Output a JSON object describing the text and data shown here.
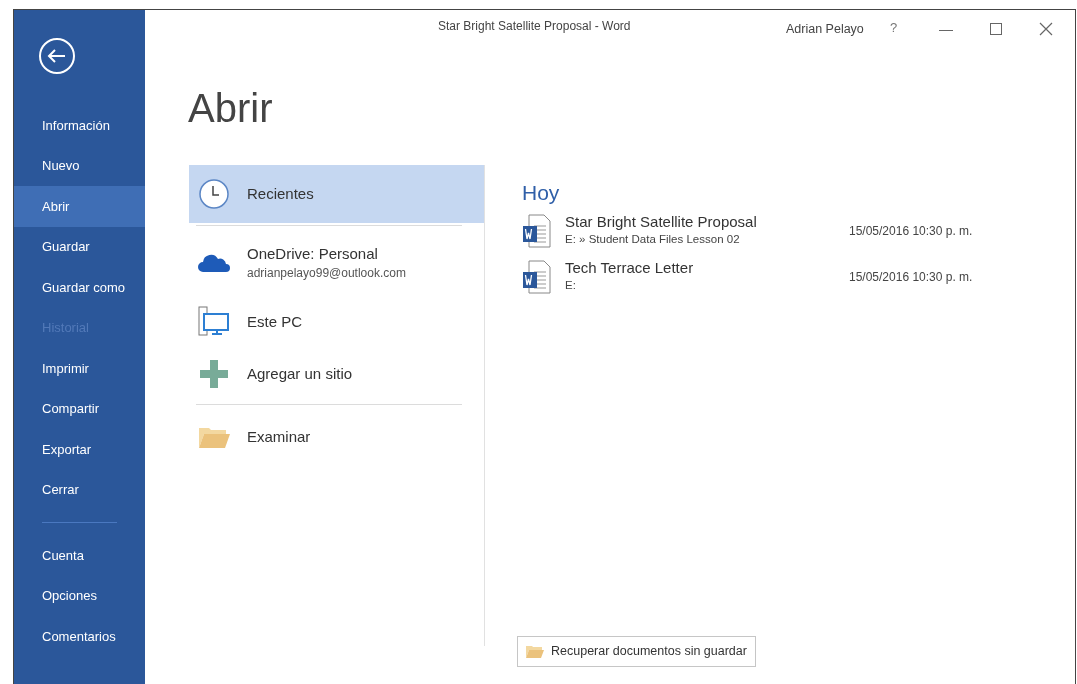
{
  "window": {
    "title": "Star Bright Satellite Proposal - Word",
    "user": "Adrian Pelayo",
    "help": "?"
  },
  "sidebar": {
    "items": [
      {
        "label": "Información",
        "selected": false,
        "disabled": false
      },
      {
        "label": "Nuevo",
        "selected": false,
        "disabled": false
      },
      {
        "label": "Abrir",
        "selected": true,
        "disabled": false
      },
      {
        "label": "Guardar",
        "selected": false,
        "disabled": false
      },
      {
        "label": "Guardar como",
        "selected": false,
        "disabled": false
      },
      {
        "label": "Historial",
        "selected": false,
        "disabled": true
      },
      {
        "label": "Imprimir",
        "selected": false,
        "disabled": false
      },
      {
        "label": "Compartir",
        "selected": false,
        "disabled": false
      },
      {
        "label": "Exportar",
        "selected": false,
        "disabled": false
      },
      {
        "label": "Cerrar",
        "selected": false,
        "disabled": false
      }
    ],
    "bottom_items": [
      {
        "label": "Cuenta",
        "selected": false,
        "disabled": false
      },
      {
        "label": "Opciones",
        "selected": false,
        "disabled": false
      },
      {
        "label": "Comentarios",
        "selected": false,
        "disabled": false
      }
    ]
  },
  "heading": "Abrir",
  "places": [
    {
      "kind": "recent",
      "label": "Recientes",
      "selected": true
    },
    {
      "kind": "onedrive",
      "label": "OneDrive: Personal",
      "sublabel": "adrianpelayo99@outlook.com",
      "selected": false
    },
    {
      "kind": "pc",
      "label": "Este PC",
      "selected": false
    },
    {
      "kind": "add",
      "label": "Agregar un sitio",
      "selected": false
    },
    {
      "kind": "browse",
      "label": "Examinar",
      "selected": false
    }
  ],
  "recent": {
    "group": "Hoy",
    "files": [
      {
        "name": "Star Bright Satellite Proposal",
        "path": "E: » Student Data Files Lesson 02",
        "date": "15/05/2016 10:30 p. m."
      },
      {
        "name": "Tech Terrace Letter",
        "path": "E:",
        "date": "15/05/2016 10:30 p. m."
      }
    ]
  },
  "recover_button": "Recuperar documentos sin guardar"
}
